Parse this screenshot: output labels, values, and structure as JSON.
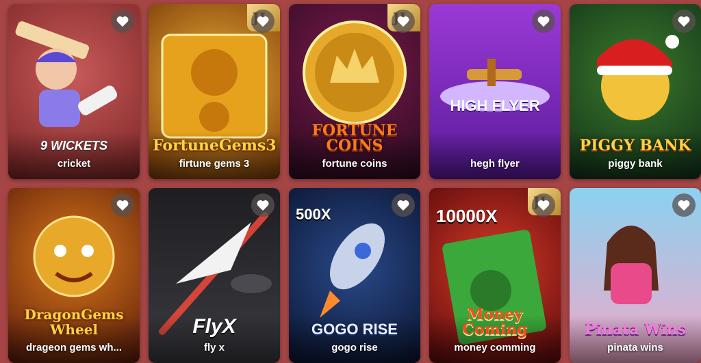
{
  "games": [
    {
      "label": "cricket",
      "logo": "9 WICKETS",
      "badge": "",
      "extra": ""
    },
    {
      "label": "firtune gems 3",
      "logo": "FortuneGems3",
      "badge": "JL",
      "extra": ""
    },
    {
      "label": "fortune coins",
      "logo": "FORTUNE COINS",
      "badge": "JL",
      "extra": ""
    },
    {
      "label": "hegh flyer",
      "logo": "HIGH FLYER",
      "badge": "",
      "extra": ""
    },
    {
      "label": "piggy bank",
      "logo": "PIGGY BANK",
      "badge": "",
      "extra": ""
    },
    {
      "label": "drageon gems wh...",
      "logo": "DragonGems Wheel",
      "badge": "",
      "extra": ""
    },
    {
      "label": "fly x",
      "logo": "FlyX",
      "badge": "",
      "extra": ""
    },
    {
      "label": "gogo rise",
      "logo": "GOGO RISE",
      "badge": "",
      "extra": "500X"
    },
    {
      "label": "money comming",
      "logo": "Money Coming",
      "badge": "JL",
      "extra": "10000X"
    },
    {
      "label": "pinata wins",
      "logo": "Pinata Wins",
      "badge": "",
      "extra": ""
    }
  ],
  "icons": {
    "favorite": "heart-icon"
  },
  "colors": {
    "background": "#a54545",
    "label": "#ffffff"
  }
}
